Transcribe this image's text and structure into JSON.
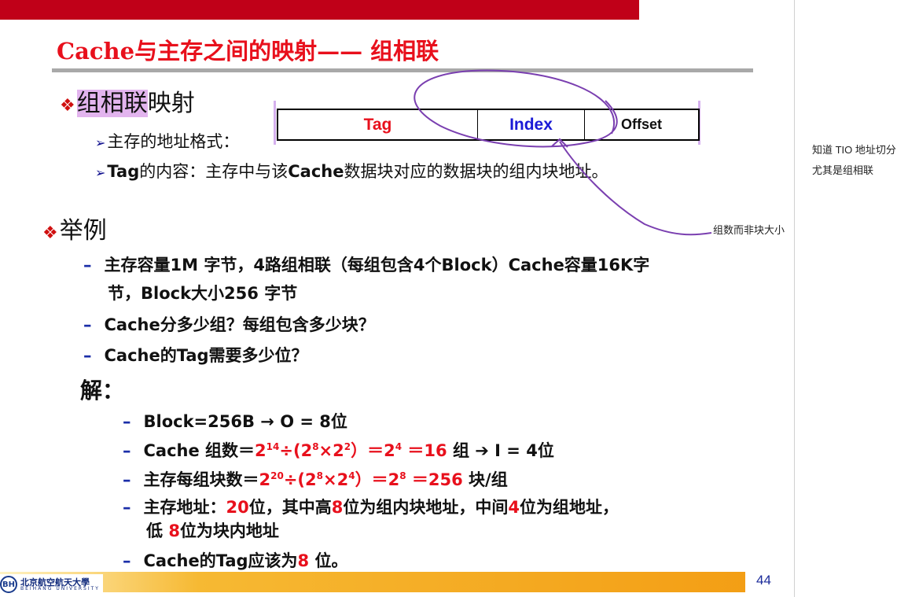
{
  "title": "Cache与主存之间的映射—— 组相联",
  "section1": {
    "bullet": "❖",
    "highlight": "组相联",
    "rest": "映射",
    "line1": "主存的地址格式：",
    "line2_tag": "Tag",
    "line2_rest": "的内容：主存中与该",
    "line2_cache": "Cache",
    "line2_tail": "数据块对应的数据块的组内块地址。"
  },
  "addr_format": {
    "tag": "Tag",
    "index": "Index",
    "offset": "Offset",
    "colors": {
      "tag": "#e8101c",
      "index": "#1a1ad6",
      "offset": "#111111"
    }
  },
  "section2": {
    "bullet": "❖",
    "heading": "举例",
    "items": [
      "主存容量1M 字节，4路组相联（每组包含4个Block）Cache容量16K字",
      "节，Block大小256 字节",
      "Cache分多少组？每组包含多少块？",
      "Cache的Tag需要多少位？"
    ],
    "solution_label": "解："
  },
  "solution": {
    "s1": "Block=256B → O = 8位",
    "s2_a": "Cache 组数＝",
    "s2_b": "2",
    "s2_c": "14",
    "s2_d": "÷(2",
    "s2_e": "8",
    "s2_f": "×2",
    "s2_g": "2",
    "s2_h": "）＝2",
    "s2_i": "4",
    "s2_j": " ＝16",
    "s2_k": " 组 ➔ I = 4位",
    "s3_a": "主存每组块数＝",
    "s3_b": "2",
    "s3_c": "20",
    "s3_d": "÷(2",
    "s3_e": "8",
    "s3_f": "×2",
    "s3_g": "4",
    "s3_h": "）＝2",
    "s3_i": "8",
    "s3_j": " ＝256",
    "s3_k": " 块/组",
    "s4_a": "主存地址：",
    "s4_b": "20",
    "s4_c": "位，其中高",
    "s4_d": "8",
    "s4_e": "位为组内块地址，中间",
    "s4_f": "4",
    "s4_g": "位为组地址，",
    "s4_h": "低 ",
    "s4_i": "8",
    "s4_j": "位为块内地址",
    "s5_a": "Cache的Tag应该为",
    "s5_b": "8",
    "s5_c": " 位。"
  },
  "annotations": {
    "handwritten_note": "组数而非块大小",
    "side_note_1": "知道 TIO 地址切分",
    "side_note_2": "尤其是组相联",
    "ink_color": "#7a3fb0"
  },
  "footer": {
    "logo_cn": "北京航空航天大學",
    "logo_en": "BEIHANG UNIVERSITY",
    "page": "44"
  }
}
